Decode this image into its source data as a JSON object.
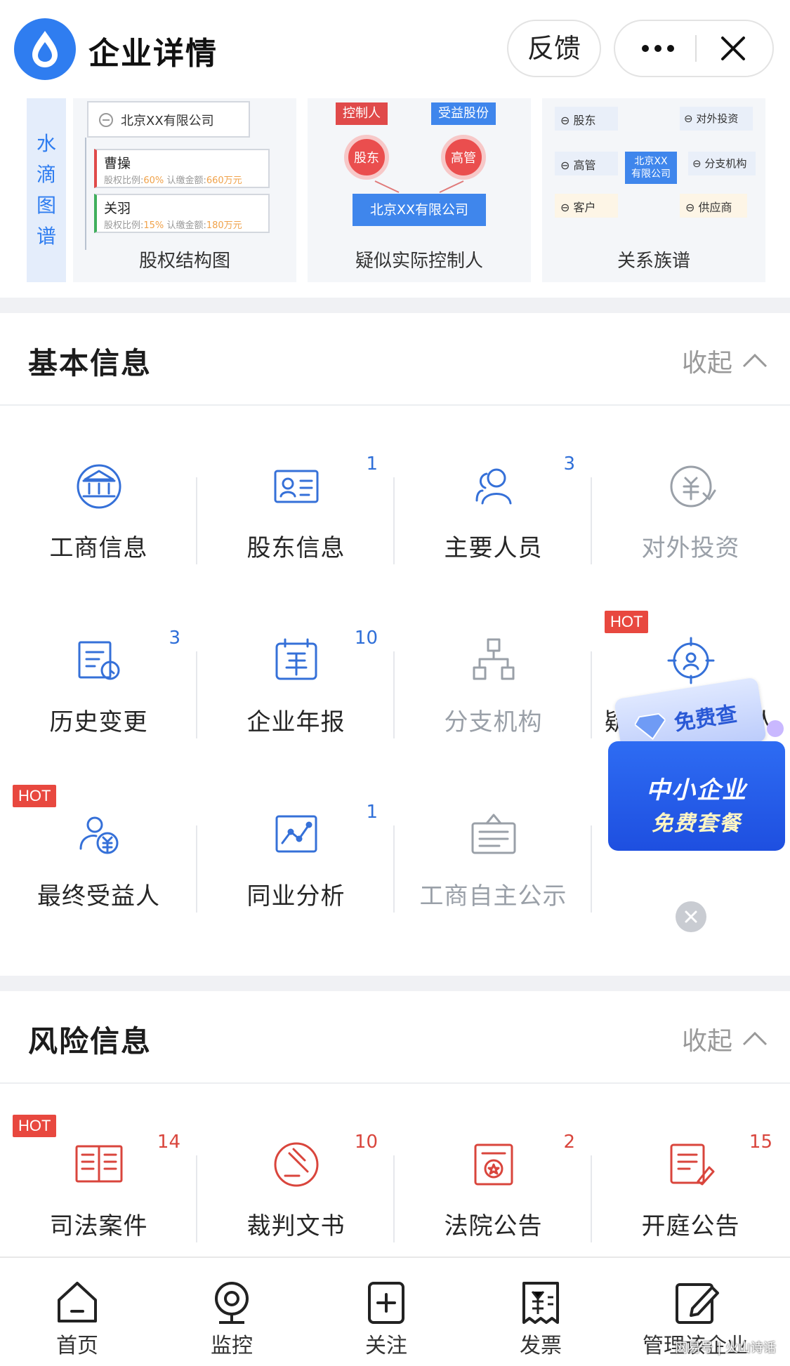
{
  "header": {
    "title": "企业详情",
    "feedback_label": "反馈"
  },
  "graph": {
    "side_label": [
      "水",
      "滴",
      "图",
      "谱"
    ],
    "cards": [
      {
        "title": "股权结构图",
        "company": "北京XX有限公司",
        "rows": [
          {
            "name": "曹操",
            "ratio_label": "股权比例:",
            "ratio": "60%",
            "paid_label": "认缴金额:",
            "paid": "660万元"
          },
          {
            "name": "关羽",
            "ratio_label": "股权比例:",
            "ratio": "15%",
            "paid_label": "认缴金额:",
            "paid": "180万元"
          }
        ]
      },
      {
        "title": "疑似实际控制人",
        "tag_left": "控制人",
        "tag_right": "受益股份",
        "node_left": "股东",
        "node_right": "高管",
        "company": "北京XX有限公司"
      },
      {
        "title": "关系族谱",
        "center": "北京XX有限公司",
        "center_line1": "北京XX",
        "center_line2": "有限公司",
        "nodes": [
          "股东",
          "对外投资",
          "高管",
          "分支机构",
          "客户",
          "供应商"
        ]
      }
    ]
  },
  "basic": {
    "title": "基本信息",
    "collapse_label": "收起",
    "items": [
      {
        "label": "工商信息",
        "count": "",
        "hot": false,
        "muted": false,
        "icon": "bank-icon"
      },
      {
        "label": "股东信息",
        "count": "1",
        "hot": false,
        "muted": false,
        "icon": "id-card-icon"
      },
      {
        "label": "主要人员",
        "count": "3",
        "hot": false,
        "muted": false,
        "icon": "people-icon"
      },
      {
        "label": "对外投资",
        "count": "",
        "hot": false,
        "muted": true,
        "icon": "investment-icon"
      },
      {
        "label": "历史变更",
        "count": "3",
        "hot": false,
        "muted": false,
        "icon": "history-icon"
      },
      {
        "label": "企业年报",
        "count": "10",
        "hot": false,
        "muted": false,
        "icon": "calendar-icon"
      },
      {
        "label": "分支机构",
        "count": "",
        "hot": false,
        "muted": true,
        "icon": "org-chart-icon"
      },
      {
        "label": "疑似实际控制人",
        "count": "",
        "hot": true,
        "muted": false,
        "icon": "target-person-icon"
      },
      {
        "label": "最终受益人",
        "count": "",
        "hot": true,
        "muted": false,
        "icon": "beneficiary-icon"
      },
      {
        "label": "同业分析",
        "count": "1",
        "hot": false,
        "muted": false,
        "icon": "analysis-chart-icon"
      },
      {
        "label": "工商自主公示",
        "count": "",
        "hot": false,
        "muted": true,
        "icon": "notice-board-icon"
      }
    ]
  },
  "risk": {
    "title": "风险信息",
    "collapse_label": "收起",
    "items": [
      {
        "label": "司法案件",
        "count": "14",
        "hot": true,
        "icon": "case-book-icon"
      },
      {
        "label": "裁判文书",
        "count": "10",
        "hot": false,
        "icon": "gavel-icon"
      },
      {
        "label": "法院公告",
        "count": "2",
        "hot": false,
        "icon": "court-notice-icon"
      },
      {
        "label": "开庭公告",
        "count": "15",
        "hot": false,
        "icon": "hearing-notice-icon"
      }
    ]
  },
  "hot_label": "HOT",
  "promo": {
    "card_text": "免费查",
    "line1": "中小企业",
    "line2": "免费套餐"
  },
  "nav": {
    "items": [
      {
        "label": "首页",
        "icon": "home-icon"
      },
      {
        "label": "监控",
        "icon": "camera-icon"
      },
      {
        "label": "关注",
        "icon": "add-follow-icon"
      },
      {
        "label": "发票",
        "icon": "invoice-icon"
      },
      {
        "label": "管理该企业",
        "icon": "edit-icon"
      }
    ]
  },
  "watermark": "网易号 | 火山诗话",
  "colors": {
    "brand_blue": "#2f7df0",
    "risk_red": "#d9453c",
    "hot_red": "#e8483f"
  }
}
